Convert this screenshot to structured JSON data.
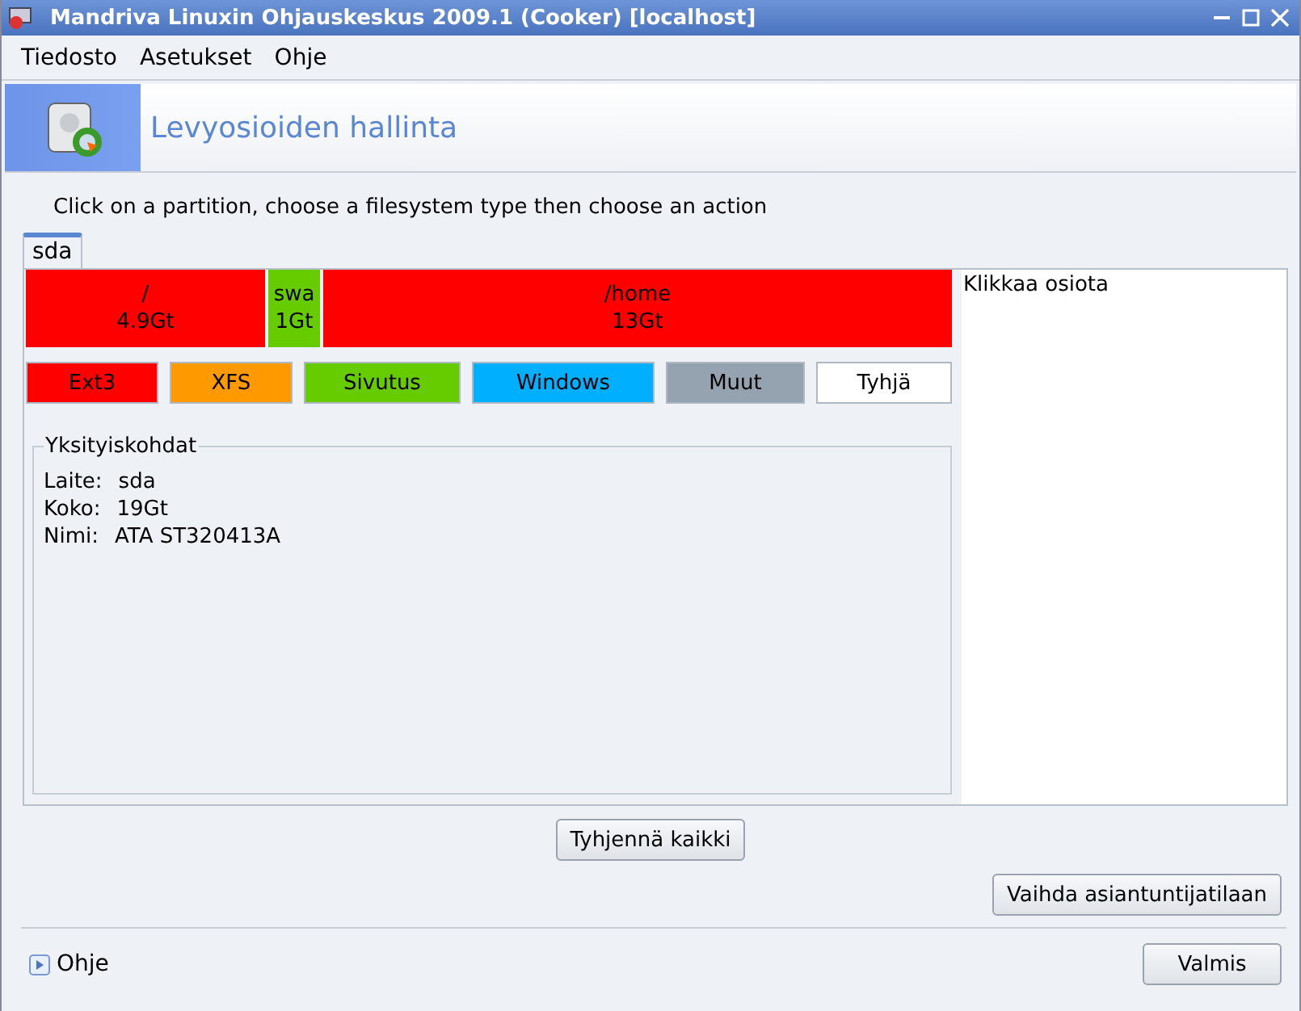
{
  "window": {
    "title": "Mandriva Linuxin Ohjauskeskus 2009.1 (Cooker) [localhost]"
  },
  "menu": [
    {
      "label": "Tiedosto"
    },
    {
      "label": "Asetukset"
    },
    {
      "label": "Ohje"
    }
  ],
  "header": {
    "title": "Levyosioiden hallinta"
  },
  "instruction": "Click on a partition, choose a filesystem type then choose an action",
  "tabs": [
    {
      "label": "sda",
      "selected": true
    }
  ],
  "partitions": [
    {
      "mount": "/",
      "size": "4.9Gt",
      "color": "#ff0000"
    },
    {
      "mount": "swa",
      "size": "1Gt",
      "color": "#66cc00"
    },
    {
      "mount": "/home",
      "size": "13Gt",
      "color": "#ff0000"
    }
  ],
  "legend": [
    {
      "label": "Ext3",
      "color": "#ff0000"
    },
    {
      "label": "XFS",
      "color": "#ff9900"
    },
    {
      "label": "Sivutus",
      "color": "#66cc00"
    },
    {
      "label": "Windows",
      "color": "#00b0ff"
    },
    {
      "label": "Muut",
      "color": "#95a2b0"
    },
    {
      "label": "Tyhjä",
      "color": "#ffffff"
    }
  ],
  "details": {
    "title": "Yksityiskohdat",
    "rows": [
      {
        "label": "Laite:",
        "value": "sda"
      },
      {
        "label": "Koko:",
        "value": "19Gt"
      },
      {
        "label": "Nimi:",
        "value": "ATA ST320413A"
      }
    ]
  },
  "side_panel": {
    "text": "Klikkaa osiota"
  },
  "buttons": {
    "clear_all": "Tyhjennä kaikki",
    "expert": "Vaihda asiantuntijatilaan",
    "help": "Ohje",
    "done": "Valmis"
  }
}
